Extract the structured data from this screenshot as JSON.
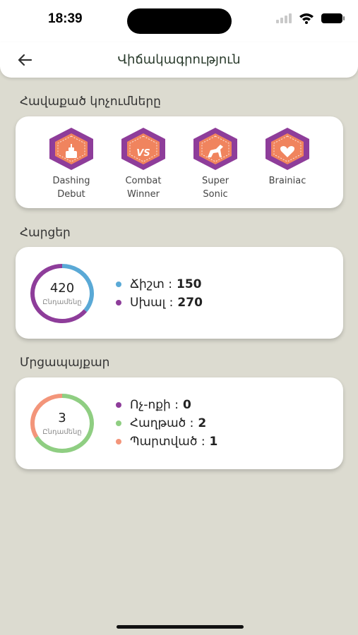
{
  "status": {
    "time": "18:39"
  },
  "header": {
    "title": "Վիճակագրություն"
  },
  "achievements": {
    "title": "Հավաքած կոչումները",
    "items": [
      {
        "label": "Dashing\nDebut",
        "icon": "cake-icon"
      },
      {
        "label": "Combat\nWinner",
        "icon": "versus-icon"
      },
      {
        "label": "Super\nSonic",
        "icon": "horse-icon"
      },
      {
        "label": "Brainiac",
        "icon": "heart-icon"
      }
    ]
  },
  "questions": {
    "title": "Հարցեր",
    "total": "420",
    "total_caption": "Ընդամենը",
    "legend": [
      {
        "label": "Ճիշտ :",
        "value": 150,
        "color": "#5aa9d6"
      },
      {
        "label": "Սխալ :",
        "value": 270,
        "color": "#8e3d9a"
      }
    ]
  },
  "tournament": {
    "title": "Մրցապայքար",
    "total": "3",
    "total_caption": "Ընդամենը",
    "legend": [
      {
        "label": "Ոչ-ոքի :",
        "value": 0,
        "color": "#8e3d9a"
      },
      {
        "label": "Հաղթած :",
        "value": 2,
        "color": "#8fce82"
      },
      {
        "label": "Պարտված :",
        "value": 1,
        "color": "#f3957a"
      }
    ]
  },
  "colors": {
    "badge_outer": "#8e3d9a",
    "badge_inner": "#f0845e",
    "background": "#dcdbd0"
  }
}
